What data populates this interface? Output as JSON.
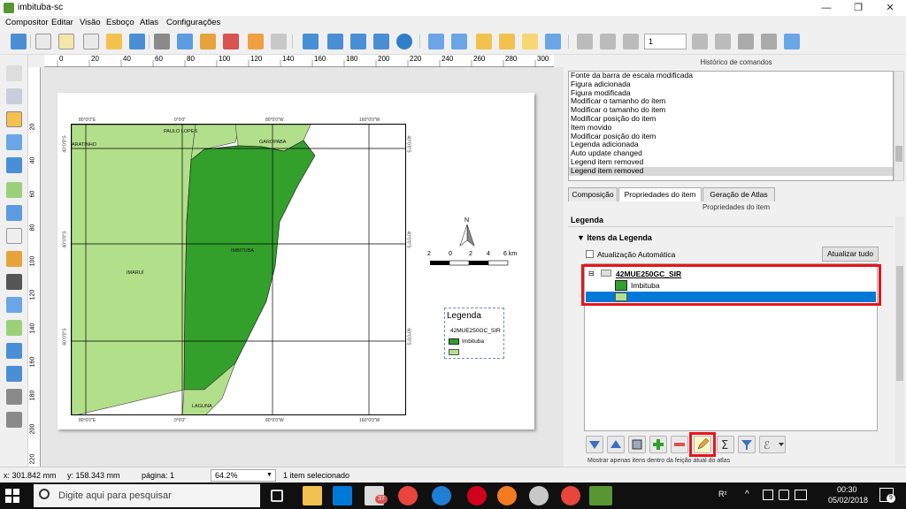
{
  "window": {
    "title": "imbituba-sc",
    "minimize": "—",
    "restore": "❐",
    "close": "✕"
  },
  "menu": [
    "Compositor",
    "Editar",
    "Visão",
    "Esboço",
    "Atlas",
    "Configurações"
  ],
  "toolbar": {
    "page_value": "1"
  },
  "ruler": {
    "h_ticks": [
      "0",
      "20",
      "40",
      "60",
      "80",
      "100",
      "120",
      "140",
      "160",
      "180",
      "200",
      "220",
      "240",
      "260",
      "280",
      "300"
    ],
    "v_ticks": [
      "20",
      "40",
      "60",
      "80",
      "100",
      "120",
      "140",
      "160",
      "180",
      "200",
      "220"
    ]
  },
  "map": {
    "top_coords": [
      "80°0'0\"E",
      "0°0'0\"",
      "80°0'0\"W",
      "160°0'0\"W"
    ],
    "bottom_coords": [
      "80°0'0\"E",
      "0°0'0\"",
      "80°0'0\"W",
      "160°0'0\"W"
    ],
    "left_coords": [
      "40°0'0\"S",
      "40°0'0\"S",
      "60°0'0\"S"
    ],
    "right_coords": [
      "40°0'0\"S",
      "40°0'0\"S",
      "60°0'0\"S"
    ],
    "labels": {
      "paulo_lopes": "PAULO LOPES",
      "garopaba": "GAROPABA",
      "imbituba": "IMBITUBA",
      "imarui": "IMARUÍ",
      "laguna": "LAGUNA",
      "aratinho": "ARATINHO"
    },
    "colors": {
      "land": "#b2df8a",
      "highlight": "#33a02c"
    }
  },
  "north": {
    "label": "N"
  },
  "scalebar": {
    "labels": [
      "2",
      "0",
      "2",
      "4",
      "6 km"
    ]
  },
  "legend_item": {
    "title": "Legenda",
    "layer": "42MUE250GC_SIR",
    "entry": "Imbituba"
  },
  "history": {
    "header": "Histórico de comandos",
    "items": [
      "Fonte da barra de escala modificada",
      "Figura adicionada",
      "Figura modificada",
      "Modificar o tamanho do item",
      "Modificar o tamanho do item",
      "Modificar posição do item",
      "Item movido",
      "Modificar posição do item",
      "Legenda adicionada",
      "Auto update changed",
      "Legend item removed",
      "Legend item removed"
    ]
  },
  "tabs": [
    "Composição",
    "Propriedades do item",
    "Geração de Atlas"
  ],
  "item_props": {
    "header": "Propriedades do item",
    "section": "Legenda",
    "group": "Itens da Legenda",
    "auto_update": "Atualização Automática",
    "update_all": "Atualizar tudo",
    "tree_layer": "42MUE250GC_SIR",
    "tree_entry": "Imbituba",
    "bottom_cut": "Mostrar apenas itens dentro da feição atual do atlas"
  },
  "status": {
    "x": "x: 301.842 mm",
    "y": "y: 158.343 mm",
    "page": "página: 1",
    "zoom": "64.2%",
    "selected": "1 item selecionado"
  },
  "taskbar": {
    "search": "Digite aqui para pesquisar",
    "time": "00:30",
    "date": "05/02/2018",
    "mail_badge": "37",
    "notif_badge": "9",
    "lang": "R²"
  }
}
